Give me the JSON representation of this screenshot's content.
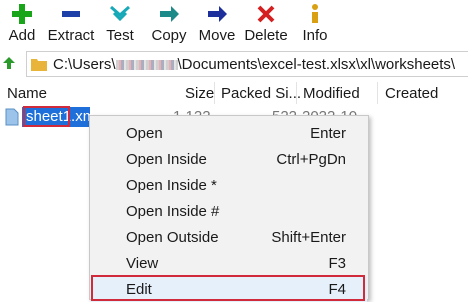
{
  "toolbar": {
    "add": "Add",
    "extract": "Extract",
    "test": "Test",
    "copy": "Copy",
    "move": "Move",
    "delete": "Delete",
    "info": "Info"
  },
  "address": {
    "path_prefix": "C:\\Users\\",
    "path_suffix": "\\Documents\\excel-test.xlsx\\xl\\worksheets\\"
  },
  "columns": {
    "name": "Name",
    "size": "Size",
    "packed": "Packed Si...",
    "modified": "Modified",
    "created": "Created"
  },
  "file": {
    "name": "sheet1.xml",
    "size": "1 122",
    "packed": "522",
    "modified": "2022-10..."
  },
  "context_menu": {
    "items": [
      {
        "label": "Open",
        "key": "Enter"
      },
      {
        "label": "Open Inside",
        "key": "Ctrl+PgDn"
      },
      {
        "label": "Open Inside *",
        "key": ""
      },
      {
        "label": "Open Inside #",
        "key": ""
      },
      {
        "label": "Open Outside",
        "key": "Shift+Enter"
      },
      {
        "label": "View",
        "key": "F3"
      },
      {
        "label": "Edit",
        "key": "F4"
      }
    ]
  },
  "colors": {
    "selection": "#1E6FD9",
    "highlight": "#d12a3a",
    "menu_bg": "#f2f2f2"
  }
}
